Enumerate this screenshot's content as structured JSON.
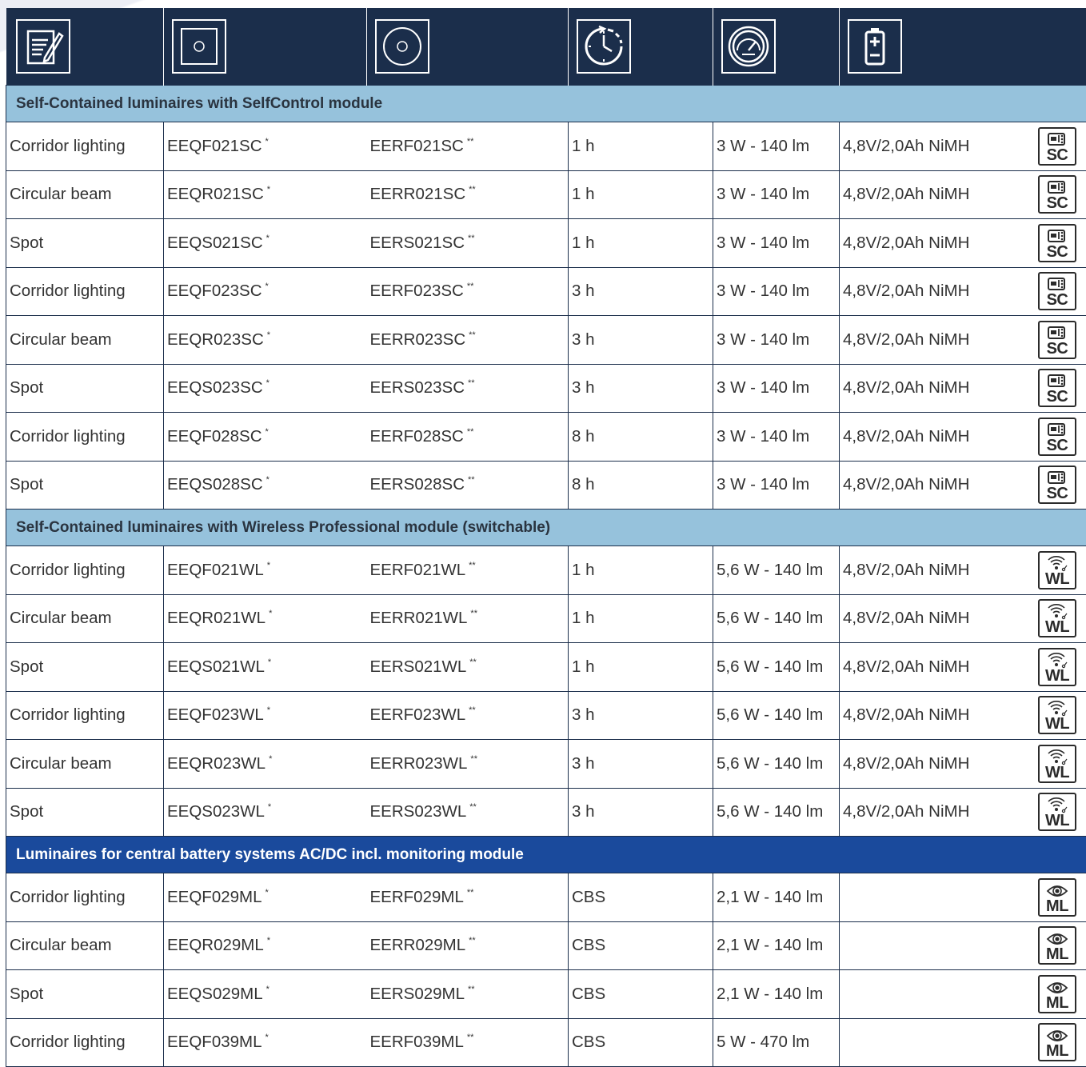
{
  "header_icons": [
    "document-edit-icon",
    "square-luminaire-icon",
    "round-luminaire-icon",
    "duration-clock-icon",
    "power-gauge-icon",
    "battery-icon"
  ],
  "marks": {
    "single": "*",
    "double": "**"
  },
  "sections": [
    {
      "title": "Self-Contained luminaires with SelfControl module",
      "style": "light",
      "badge": "SC",
      "rows": [
        {
          "type": "Corridor lighting",
          "code_square": "EEQF021SC",
          "code_round": "EERF021SC",
          "duration": "1 h",
          "power": "3 W - 140 lm",
          "battery": "4,8V/2,0Ah NiMH"
        },
        {
          "type": "Circular beam",
          "code_square": "EEQR021SC",
          "code_round": "EERR021SC",
          "duration": "1 h",
          "power": "3 W - 140 lm",
          "battery": "4,8V/2,0Ah NiMH"
        },
        {
          "type": "Spot",
          "code_square": "EEQS021SC",
          "code_round": "EERS021SC",
          "duration": "1 h",
          "power": "3 W - 140 lm",
          "battery": "4,8V/2,0Ah NiMH"
        },
        {
          "type": "Corridor lighting",
          "code_square": "EEQF023SC",
          "code_round": "EERF023SC",
          "duration": "3 h",
          "power": "3 W - 140 lm",
          "battery": "4,8V/2,0Ah NiMH"
        },
        {
          "type": "Circular beam",
          "code_square": "EEQR023SC",
          "code_round": "EERR023SC",
          "duration": "3 h",
          "power": "3 W - 140 lm",
          "battery": "4,8V/2,0Ah NiMH"
        },
        {
          "type": "Spot",
          "code_square": "EEQS023SC",
          "code_round": "EERS023SC",
          "duration": "3 h",
          "power": "3 W - 140 lm",
          "battery": "4,8V/2,0Ah NiMH"
        },
        {
          "type": "Corridor lighting",
          "code_square": "EEQF028SC",
          "code_round": "EERF028SC",
          "duration": "8 h",
          "power": "3 W - 140 lm",
          "battery": "4,8V/2,0Ah NiMH"
        },
        {
          "type": "Spot",
          "code_square": "EEQS028SC",
          "code_round": "EERS028SC",
          "duration": "8 h",
          "power": "3 W - 140 lm",
          "battery": "4,8V/2,0Ah NiMH"
        }
      ]
    },
    {
      "title": "Self-Contained luminaires with Wireless Professional module (switchable)",
      "style": "light",
      "badge": "WL",
      "rows": [
        {
          "type": "Corridor lighting",
          "code_square": "EEQF021WL",
          "code_round": "EERF021WL",
          "duration": "1 h",
          "power": "5,6 W - 140 lm",
          "battery": "4,8V/2,0Ah NiMH"
        },
        {
          "type": "Circular beam",
          "code_square": "EEQR021WL",
          "code_round": "EERR021WL",
          "duration": "1 h",
          "power": "5,6 W - 140 lm",
          "battery": "4,8V/2,0Ah NiMH"
        },
        {
          "type": "Spot",
          "code_square": "EEQS021WL",
          "code_round": "EERS021WL",
          "duration": "1 h",
          "power": "5,6 W - 140 lm",
          "battery": "4,8V/2,0Ah NiMH"
        },
        {
          "type": "Corridor lighting",
          "code_square": "EEQF023WL",
          "code_round": "EERF023WL",
          "duration": "3 h",
          "power": "5,6 W - 140 lm",
          "battery": "4,8V/2,0Ah NiMH"
        },
        {
          "type": "Circular beam",
          "code_square": "EEQR023WL",
          "code_round": "EERR023WL",
          "duration": "3 h",
          "power": "5,6 W - 140 lm",
          "battery": "4,8V/2,0Ah NiMH"
        },
        {
          "type": "Spot",
          "code_square": "EEQS023WL",
          "code_round": "EERS023WL",
          "duration": "3 h",
          "power": "5,6 W - 140 lm",
          "battery": "4,8V/2,0Ah NiMH"
        }
      ]
    },
    {
      "title": "Luminaires for central battery systems AC/DC incl. monitoring module",
      "style": "dark",
      "badge": "ML",
      "rows": [
        {
          "type": "Corridor lighting",
          "code_square": "EEQF029ML",
          "code_round": "EERF029ML",
          "duration": "CBS",
          "power": "2,1 W - 140 lm",
          "battery": ""
        },
        {
          "type": "Circular beam",
          "code_square": "EEQR029ML",
          "code_round": "EERR029ML",
          "duration": "CBS",
          "power": "2,1 W - 140 lm",
          "battery": ""
        },
        {
          "type": "Spot",
          "code_square": "EEQS029ML",
          "code_round": "EERS029ML",
          "duration": "CBS",
          "power": "2,1 W - 140 lm",
          "battery": ""
        },
        {
          "type": "Corridor lighting",
          "code_square": "EEQF039ML",
          "code_round": "EERF039ML",
          "duration": "CBS",
          "power": "5 W - 470 lm",
          "battery": ""
        }
      ]
    }
  ],
  "colors": {
    "header_bg": "#1b2e4b",
    "section_light": "#96c2dc",
    "section_dark": "#1a4a9c"
  }
}
